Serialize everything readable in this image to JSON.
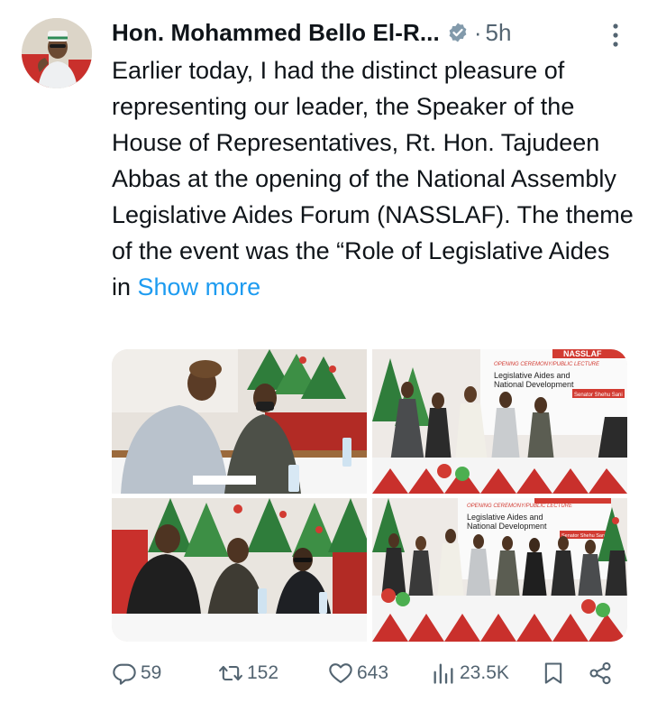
{
  "tweet": {
    "author_name": "Hon. Mohammed Bello El-R...",
    "separator": "·",
    "timestamp": "5h",
    "text_body": "Earlier today, I had the distinct pleasure of representing our leader, the Speaker of the House of Representatives, Rt. Hon. Tajudeen Abbas at the opening of the National Assembly Legislative Aides Forum (NASSLAF). The theme of the event was the “Role of Legislative Aides in ",
    "show_more": "Show more"
  },
  "photos": {
    "banner1_line1": "OPENING CEREMONY/PUBLIC LECTURE",
    "banner1_line2": "Legislative Aides and",
    "banner1_line3": "National Development",
    "banner1_tag": "Senator Shehu Sani",
    "banner1_brand": "NASSLAF",
    "banner2_line1": "OPENING CEREMONY/PUBLIC LECTURE",
    "banner2_line2": "Legislative Aides and",
    "banner2_line3": "National Development",
    "banner2_tag": "Senator Shehu Sani"
  },
  "actions": {
    "replies": "59",
    "reposts": "152",
    "likes": "643",
    "views": "23.5K"
  },
  "colors": {
    "accent": "#1d9bf0",
    "muted": "#536471",
    "text": "#0f1419",
    "verified": "#829aab"
  }
}
